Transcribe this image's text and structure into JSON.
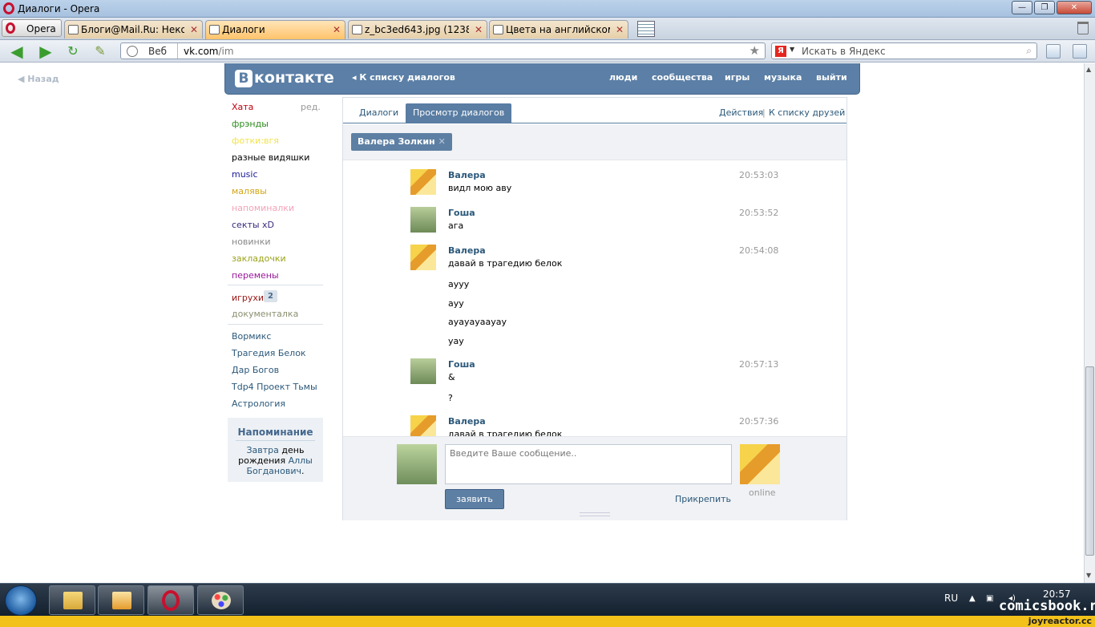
{
  "window": {
    "title": "Диалоги - Opera"
  },
  "tabbar": {
    "opera_label": "Opera",
    "tabs": [
      {
        "label": "Блоги@Mail.Ru: Неко...",
        "close": "✕"
      },
      {
        "label": "Диалоги",
        "close": "✕"
      },
      {
        "label": "z_bc3ed643.jpg (1238×...",
        "close": "✕"
      },
      {
        "label": "Цвета на английском ...",
        "close": "✕"
      }
    ]
  },
  "addressbar": {
    "web_label": "Веб",
    "url_host": "vk.com",
    "url_path": "/im",
    "search_placeholder": "Искать в Яндекс",
    "search_engine": "Я"
  },
  "page": {
    "back_label": "Назад"
  },
  "vk": {
    "logo_b": "В",
    "logo_text": "контакте",
    "back_to_list": "К списку диалогов",
    "nav": [
      "люди",
      "сообщества",
      "игры",
      "музыка",
      "выйти"
    ]
  },
  "menu": {
    "edit": "ред.",
    "items": [
      {
        "label": "Хата",
        "color": "#c0000f"
      },
      {
        "label": "фрэнды",
        "color": "#2e8b1f"
      },
      {
        "label": "фотки:вгя",
        "color": "#f2e34a"
      },
      {
        "label": "разные видяшки",
        "color": "#000000"
      },
      {
        "label": "music",
        "color": "#1a1a9a"
      },
      {
        "label": "малявы",
        "color": "#d2a619"
      },
      {
        "label": "напоминалки",
        "color": "#f3a3b8"
      },
      {
        "label": "секты xD",
        "color": "#3a2a7a"
      },
      {
        "label": "новинки",
        "color": "#888888"
      },
      {
        "label": "закладочки",
        "color": "#9aa318"
      },
      {
        "label": "перемены",
        "color": "#9a179a"
      },
      {
        "label": "игрухи",
        "color": "#9a1515"
      },
      {
        "label": "документалка",
        "color": "#8a8f70"
      },
      {
        "label": "Вормикс",
        "color": "#2b587a"
      },
      {
        "label": "Трагедия Белок",
        "color": "#2b587a"
      },
      {
        "label": "Дар Богов",
        "color": "#2b587a"
      },
      {
        "label": "Tdp4 Проект Тьмы",
        "color": "#2b587a"
      },
      {
        "label": "Астрология",
        "color": "#2b587a"
      }
    ],
    "games_badge": "2",
    "reminder": {
      "title": "Напоминание",
      "line1": "Завтра",
      "line1b": "день",
      "line2": "рождения",
      "line2b": "Аллы",
      "line3": "Богданович",
      "line3b": "."
    }
  },
  "dialogs": {
    "tab_dialogs": "Диалоги",
    "tab_view": "Просмотр диалогов",
    "actions": "Действия",
    "sep": "|",
    "friends_list": "К списку друзей",
    "recipient": "Валера Золкин",
    "recipient_close": "✕",
    "messages": [
      {
        "name": "Валера",
        "time": "20:53:03",
        "lines": [
          "видл мою аву"
        ]
      },
      {
        "name": "Гоша",
        "time": "20:53:52",
        "lines": [
          "ага"
        ]
      },
      {
        "name": "Валера",
        "time": "20:54:08",
        "lines": [
          "давай в трагедию белок",
          "ayyy",
          "ayy",
          "ayayayaayay",
          "yay"
        ]
      },
      {
        "name": "Гоша",
        "time": "20:57:13",
        "lines": [
          "&",
          "?"
        ]
      },
      {
        "name": "Валера",
        "time": "20:57:36",
        "lines": [
          "давай в трагедию белок"
        ]
      }
    ],
    "composer_placeholder": "Введите Ваше сообщение..",
    "send": "заявить",
    "attach": "Прикрепить",
    "online": "online"
  },
  "taskbar": {
    "lang": "RU",
    "clock": "20:57"
  },
  "watermark": {
    "top": "comicsbook.ru",
    "bottom": "joyreactor.cc"
  },
  "colors": {
    "vk_blue": "#5b7fa6",
    "link": "#2b587a",
    "opera_red": "#c8102e"
  }
}
